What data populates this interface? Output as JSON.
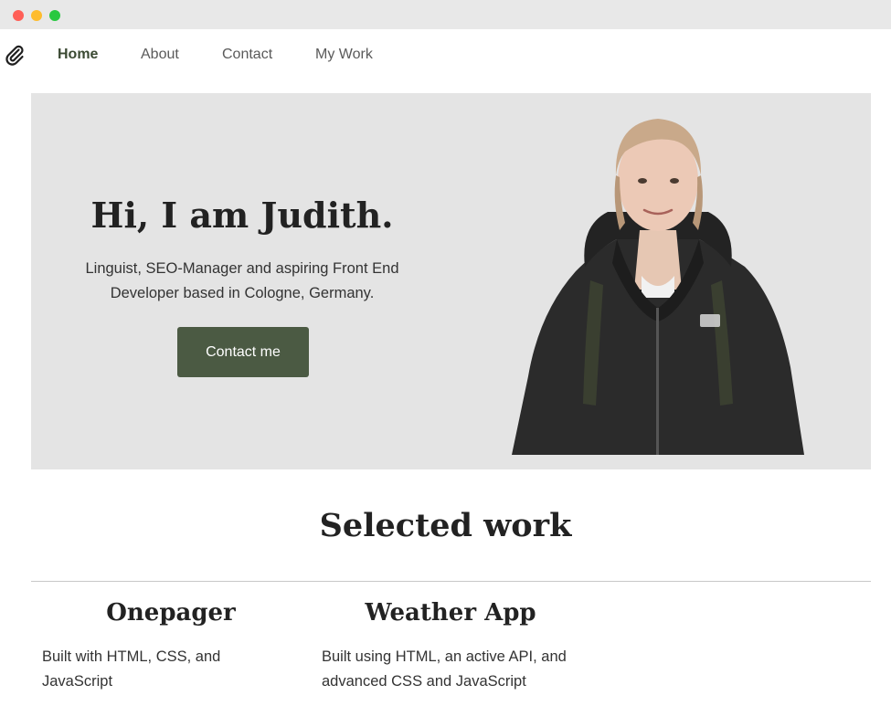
{
  "window": {
    "controls": [
      "close",
      "minimize",
      "zoom"
    ]
  },
  "nav": {
    "logo_icon": "paperclip-icon",
    "links": [
      {
        "label": "Home",
        "active": true
      },
      {
        "label": "About",
        "active": false
      },
      {
        "label": "Contact",
        "active": false
      },
      {
        "label": "My Work",
        "active": false
      }
    ]
  },
  "hero": {
    "title": "Hi, I am Judith.",
    "subtitle": "Linguist, SEO-Manager and aspiring Front End Developer based in Cologne, Germany.",
    "cta_label": "Contact me",
    "portrait_icon": "portrait-photo"
  },
  "work": {
    "title": "Selected work",
    "projects": [
      {
        "title": "Onepager",
        "description": "Built with HTML, CSS, and JavaScript"
      },
      {
        "title": "Weather App",
        "description": "Built using HTML, an active API, and advanced CSS and JavaScript"
      }
    ]
  },
  "colors": {
    "accent": "#4b5a43",
    "nav_active": "#3b4a33",
    "hero_bg": "#e4e4e4",
    "titlebar": "#e8e8e8"
  }
}
